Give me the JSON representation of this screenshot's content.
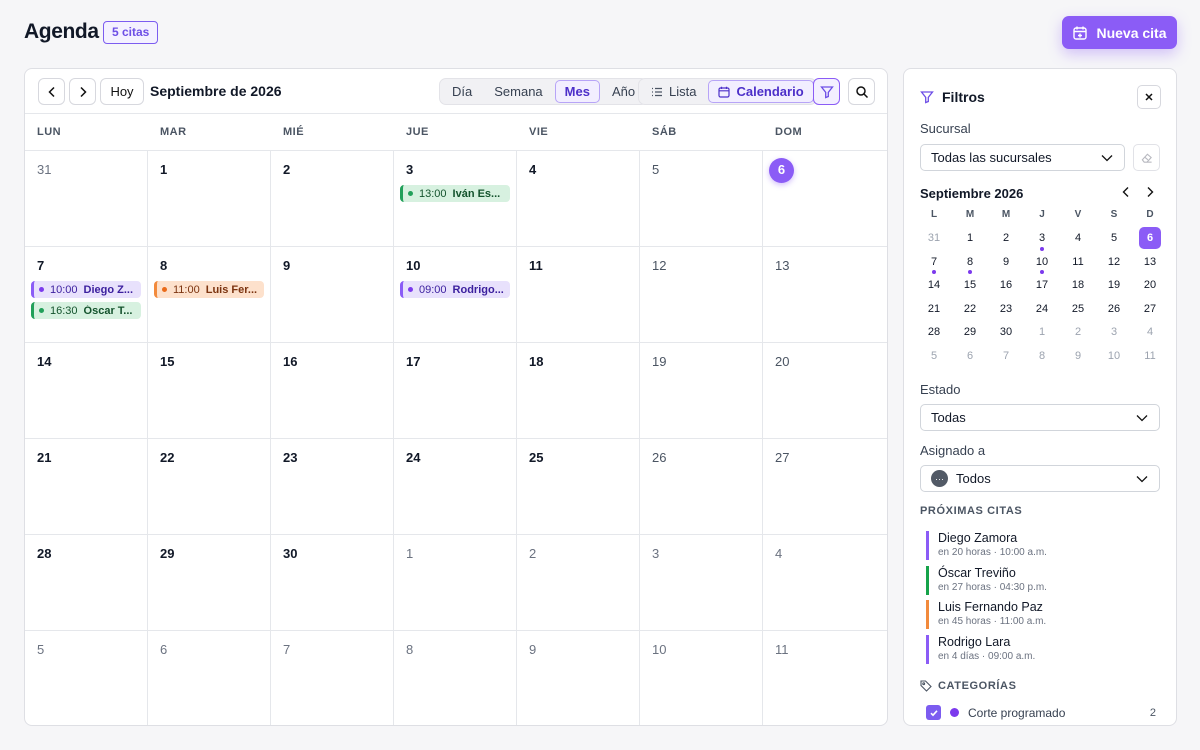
{
  "header": {
    "title": "Agenda",
    "count_badge": "5 citas",
    "new_button": "Nueva cita"
  },
  "toolbar": {
    "today_button": "Hoy",
    "month_title": "Septiembre de 2026",
    "views": [
      "Día",
      "Semana",
      "Mes",
      "Año"
    ],
    "active_view": "Mes",
    "modes": [
      "Lista",
      "Calendario"
    ],
    "active_mode": "Calendario"
  },
  "calendar": {
    "weekdays": [
      "LUN",
      "MAR",
      "MIÉ",
      "JUE",
      "VIE",
      "SÁB",
      "DOM"
    ],
    "weeks": [
      [
        {
          "n": "31",
          "muted": true
        },
        {
          "n": "1"
        },
        {
          "n": "2"
        },
        {
          "n": "3",
          "events": [
            {
              "time": "13:00",
              "who": "Iván Es...",
              "color": "green"
            }
          ]
        },
        {
          "n": "4"
        },
        {
          "n": "5",
          "weekend": true
        },
        {
          "n": "6",
          "today": true
        }
      ],
      [
        {
          "n": "7",
          "events": [
            {
              "time": "10:00",
              "who": "Diego Z...",
              "color": "purple"
            },
            {
              "time": "16:30",
              "who": "Óscar T...",
              "color": "green"
            }
          ]
        },
        {
          "n": "8",
          "events": [
            {
              "time": "11:00",
              "who": "Luis Fer...",
              "color": "orange"
            }
          ]
        },
        {
          "n": "9"
        },
        {
          "n": "10",
          "events": [
            {
              "time": "09:00",
              "who": "Rodrigo...",
              "color": "purple"
            }
          ]
        },
        {
          "n": "11"
        },
        {
          "n": "12",
          "weekend": true
        },
        {
          "n": "13",
          "weekend": true
        }
      ],
      [
        {
          "n": "14"
        },
        {
          "n": "15"
        },
        {
          "n": "16"
        },
        {
          "n": "17"
        },
        {
          "n": "18"
        },
        {
          "n": "19",
          "weekend": true
        },
        {
          "n": "20",
          "weekend": true
        }
      ],
      [
        {
          "n": "21"
        },
        {
          "n": "22"
        },
        {
          "n": "23"
        },
        {
          "n": "24"
        },
        {
          "n": "25"
        },
        {
          "n": "26",
          "weekend": true
        },
        {
          "n": "27",
          "weekend": true
        }
      ],
      [
        {
          "n": "28"
        },
        {
          "n": "29"
        },
        {
          "n": "30"
        },
        {
          "n": "1",
          "muted": true
        },
        {
          "n": "2",
          "muted": true
        },
        {
          "n": "3",
          "muted": true
        },
        {
          "n": "4",
          "muted": true
        }
      ],
      [
        {
          "n": "5",
          "muted": true
        },
        {
          "n": "6",
          "muted": true
        },
        {
          "n": "7",
          "muted": true
        },
        {
          "n": "8",
          "muted": true
        },
        {
          "n": "9",
          "muted": true
        },
        {
          "n": "10",
          "muted": true
        },
        {
          "n": "11",
          "muted": true
        }
      ]
    ]
  },
  "sidebar": {
    "title": "Filtros",
    "branch_label": "Sucursal",
    "branch_value": "Todas las sucursales",
    "mini_title": "Septiembre 2026",
    "mini_weekdays": [
      "L",
      "M",
      "M",
      "J",
      "V",
      "S",
      "D"
    ],
    "mini_days": [
      {
        "n": "31",
        "out": true
      },
      {
        "n": "1"
      },
      {
        "n": "2"
      },
      {
        "n": "3",
        "dot": true
      },
      {
        "n": "4"
      },
      {
        "n": "5"
      },
      {
        "n": "6",
        "sel": true
      },
      {
        "n": "7",
        "dot": true
      },
      {
        "n": "8",
        "dot": true
      },
      {
        "n": "9"
      },
      {
        "n": "10",
        "dot": true
      },
      {
        "n": "11"
      },
      {
        "n": "12"
      },
      {
        "n": "13"
      },
      {
        "n": "14"
      },
      {
        "n": "15"
      },
      {
        "n": "16"
      },
      {
        "n": "17"
      },
      {
        "n": "18"
      },
      {
        "n": "19"
      },
      {
        "n": "20"
      },
      {
        "n": "21"
      },
      {
        "n": "22"
      },
      {
        "n": "23"
      },
      {
        "n": "24"
      },
      {
        "n": "25"
      },
      {
        "n": "26"
      },
      {
        "n": "27"
      },
      {
        "n": "28"
      },
      {
        "n": "29"
      },
      {
        "n": "30"
      },
      {
        "n": "1",
        "out": true
      },
      {
        "n": "2",
        "out": true
      },
      {
        "n": "3",
        "out": true
      },
      {
        "n": "4",
        "out": true
      },
      {
        "n": "5",
        "out": true
      },
      {
        "n": "6",
        "out": true
      },
      {
        "n": "7",
        "out": true
      },
      {
        "n": "8",
        "out": true
      },
      {
        "n": "9",
        "out": true
      },
      {
        "n": "10",
        "out": true
      },
      {
        "n": "11",
        "out": true
      }
    ],
    "status_label": "Estado",
    "status_value": "Todas",
    "assigned_label": "Asignado a",
    "assigned_value": "Todos",
    "upcoming_title": "PRÓXIMAS CITAS",
    "upcoming": [
      {
        "name": "Diego Zamora",
        "meta": "en 20 horas · 10:00 a.m.",
        "color": "#8b5cf6"
      },
      {
        "name": "Óscar Treviño",
        "meta": "en 27 horas · 04:30 p.m.",
        "color": "#16a34a"
      },
      {
        "name": "Luis Fernando Paz",
        "meta": "en 45 horas · 11:00 a.m.",
        "color": "#f28a3c"
      },
      {
        "name": "Rodrigo Lara",
        "meta": "en 4 días · 09:00 a.m.",
        "color": "#8b5cf6"
      }
    ],
    "categories_title": "CATEGORÍAS",
    "category": {
      "label": "Corte programado",
      "count": "2"
    }
  }
}
